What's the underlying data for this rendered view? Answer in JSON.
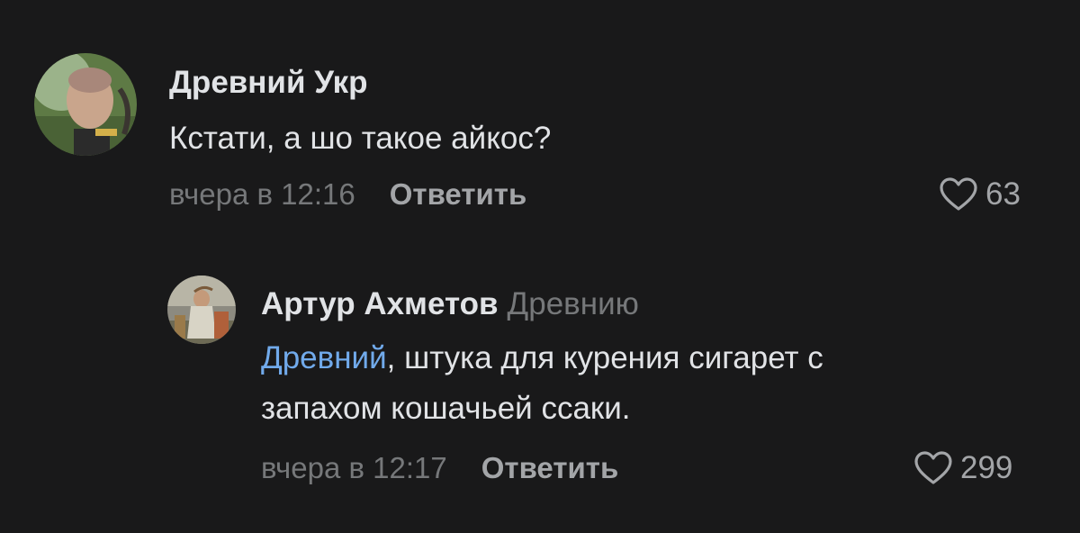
{
  "colors": {
    "background": "#19191a",
    "text": "#e1e3e6",
    "secondary": "#76787a",
    "action": "#a3a5a8",
    "link": "#71aaeb"
  },
  "comments": [
    {
      "author": "Древний Укр",
      "text": "Кстати, а шо такое айкос?",
      "time": "вчера в 12:16",
      "reply_label": "Ответить",
      "likes": "63"
    },
    {
      "author": "Артур Ахметов",
      "reply_to": "Древнию",
      "mention": "Древний",
      "text_line1_rest": ", штука для курения сигарет с",
      "text_line2": "запахом кошачьей ссаки.",
      "time": "вчера в 12:17",
      "reply_label": "Ответить",
      "likes": "299"
    }
  ]
}
